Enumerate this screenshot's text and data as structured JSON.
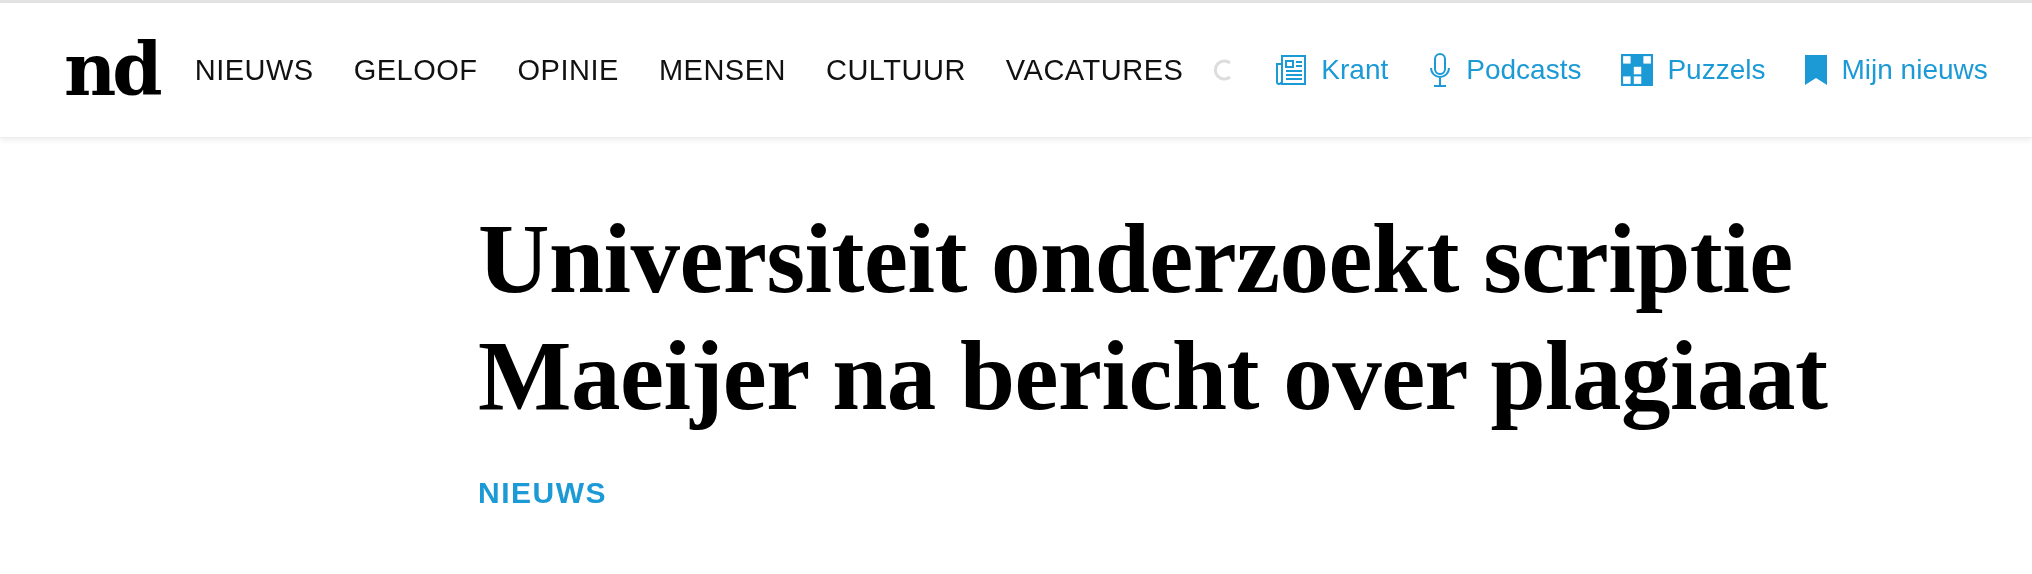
{
  "header": {
    "logo": "nd",
    "nav": [
      "NIEUWS",
      "GELOOF",
      "OPINIE",
      "MENSEN",
      "CULTUUR",
      "VACATURES"
    ],
    "links": [
      {
        "kind": "newspaper",
        "label": "Krant"
      },
      {
        "kind": "microphone",
        "label": "Podcasts"
      },
      {
        "kind": "puzzle",
        "label": "Puzzels"
      },
      {
        "kind": "bookmark",
        "label": "Mijn nieuws"
      }
    ]
  },
  "article": {
    "title": "Universiteit onderzoekt scriptie Maeijer na bericht over plagiaat",
    "section": "NIEUWS"
  }
}
